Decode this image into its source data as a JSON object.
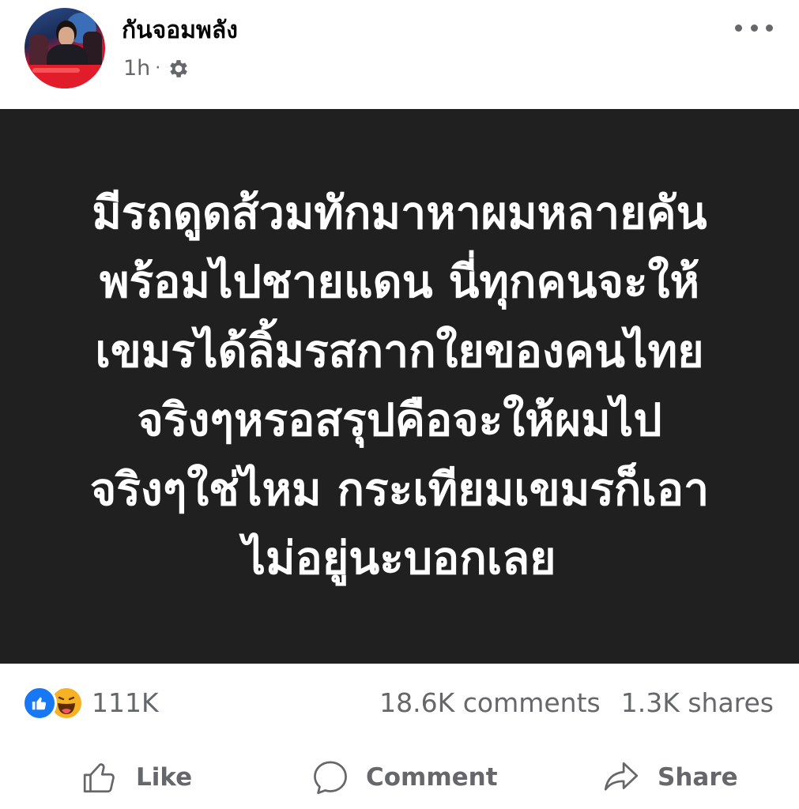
{
  "post": {
    "author": "กันจอมพลัง",
    "time": "1h",
    "separator": "·",
    "privacy_icon": "gear-icon",
    "lines": [
      "มีรถดูดส้วมทักมาหาผมหลายคัน",
      "พร้อมไปชายแดน นี่ทุกคนจะให้",
      "เขมรได้ลิ้มรสกากใยของคนไทย",
      "จริงๆหรอสรุปคือจะให้ผมไป",
      "จริงๆใช่ไหม กระเทียมเขมรก็เอา",
      "ไม่อยู่นะบอกเลย"
    ],
    "card_background": "#202020"
  },
  "stats": {
    "reactions_count": "111K",
    "comments": "18.6K comments",
    "shares": "1.3K shares"
  },
  "actions": {
    "like": "Like",
    "comment": "Comment",
    "share": "Share"
  },
  "colors": {
    "like_blue": "#1877f2",
    "haha_yellow": "#f7b125",
    "secondary_text": "#65676b"
  }
}
